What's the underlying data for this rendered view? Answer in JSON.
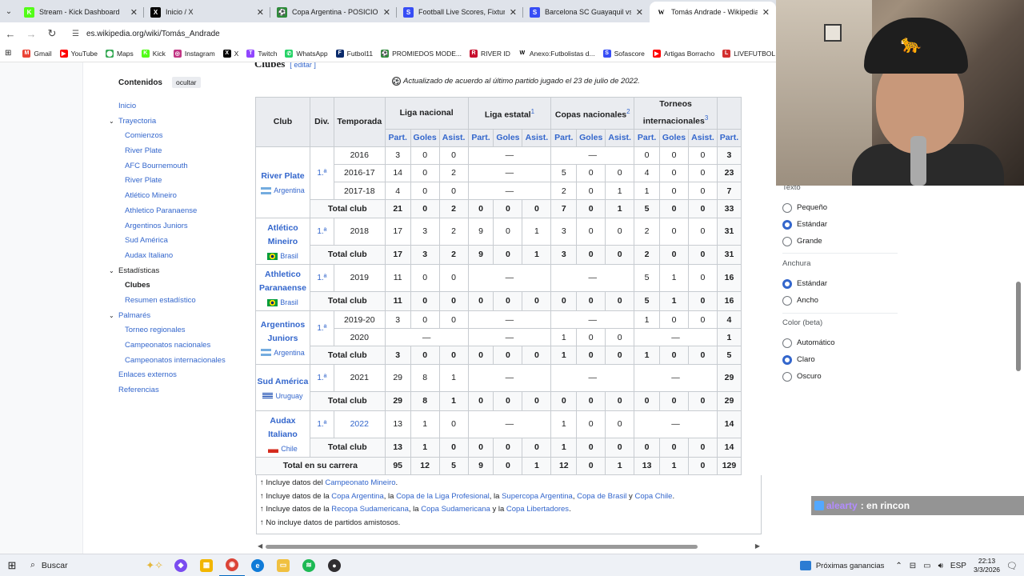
{
  "browser": {
    "tabs": [
      {
        "title": "Stream - Kick Dashboard",
        "icon": "kick-icon",
        "color": "#53fc18",
        "glyph": "K"
      },
      {
        "title": "Inicio / X",
        "icon": "x-icon",
        "color": "#000000",
        "glyph": "X"
      },
      {
        "title": "Copa Argentina - POSICIONES",
        "icon": "promiedos-icon",
        "color": "#2e8b3a",
        "glyph": "⚽"
      },
      {
        "title": "Football Live Scores, Fixtures &",
        "icon": "sofascore-icon",
        "color": "#374df5",
        "glyph": "S"
      },
      {
        "title": "Barcelona SC Guayaquil vs Bota",
        "icon": "sofascore-icon",
        "color": "#374df5",
        "glyph": "S"
      },
      {
        "title": "Tomás Andrade - Wikipedia, la",
        "icon": "wikipedia-icon",
        "color": "#ffffff",
        "glyph": "W"
      }
    ],
    "url": "es.wikipedia.org/wiki/Tomás_Andrade",
    "bookmarks": [
      {
        "label": "Gmail",
        "color": "#ea4335",
        "glyph": "M"
      },
      {
        "label": "YouTube",
        "color": "#ff0000",
        "glyph": "▶"
      },
      {
        "label": "Maps",
        "color": "#34a853",
        "glyph": "⬤"
      },
      {
        "label": "Kick",
        "color": "#53fc18",
        "glyph": "K"
      },
      {
        "label": "Instagram",
        "color": "#c13584",
        "glyph": "◎"
      },
      {
        "label": "X",
        "color": "#000000",
        "glyph": "X"
      },
      {
        "label": "Twitch",
        "color": "#9146ff",
        "glyph": "T"
      },
      {
        "label": "WhatsApp",
        "color": "#25d366",
        "glyph": "✆"
      },
      {
        "label": "Futbol11",
        "color": "#0a2b6b",
        "glyph": "F"
      },
      {
        "label": "PROMIEDOS MODE...",
        "color": "#2e8b3a",
        "glyph": "⚽"
      },
      {
        "label": "RIVER ID",
        "color": "#c8102e",
        "glyph": "R"
      },
      {
        "label": "Anexo:Futbolistas d...",
        "color": "#ffffff",
        "glyph": "W"
      },
      {
        "label": "Sofascore",
        "color": "#374df5",
        "glyph": "S"
      },
      {
        "label": "Artigas Borracho",
        "color": "#ff0000",
        "glyph": "▶"
      },
      {
        "label": "LIVEFUTBOL",
        "color": "#d32f2f",
        "glyph": "L"
      }
    ]
  },
  "toc": {
    "title": "Contenidos",
    "hide_label": "ocultar",
    "items": [
      {
        "label": "Inicio",
        "level": 1
      },
      {
        "label": "Trayectoria",
        "level": 1,
        "chev": true
      },
      {
        "label": "Comienzos",
        "level": 2
      },
      {
        "label": "River Plate",
        "level": 2
      },
      {
        "label": "AFC Bournemouth",
        "level": 2
      },
      {
        "label": "River Plate",
        "level": 2
      },
      {
        "label": "Atlético Mineiro",
        "level": 2
      },
      {
        "label": "Athletico Paranaense",
        "level": 2
      },
      {
        "label": "Argentinos Juniors",
        "level": 2
      },
      {
        "label": "Sud América",
        "level": 2
      },
      {
        "label": "Audax Italiano",
        "level": 2
      },
      {
        "label": "Estadísticas",
        "level": 1,
        "chev": true,
        "dark": true
      },
      {
        "label": "Clubes",
        "level": 2,
        "current": true
      },
      {
        "label": "Resumen estadístico",
        "level": 2
      },
      {
        "label": "Palmarés",
        "level": 1,
        "chev": true
      },
      {
        "label": "Torneo regionales",
        "level": 2
      },
      {
        "label": "Campeonatos nacionales",
        "level": 2
      },
      {
        "label": "Campeonatos internacionales",
        "level": 2
      },
      {
        "label": "Enlaces externos",
        "level": 1
      },
      {
        "label": "Referencias",
        "level": 1
      }
    ]
  },
  "article": {
    "section_title": "Clubes",
    "edit_label": "editar",
    "updated_note": "Actualizado de acuerdo al último partido jugado el 23 de julio de 2022.",
    "table": {
      "headers": {
        "club": "Club",
        "div": "Div.",
        "season": "Temporada",
        "groups": [
          {
            "label": "Liga nacional",
            "sup": ""
          },
          {
            "label": "Liga estatal",
            "sup": "1"
          },
          {
            "label": "Copas nacionales",
            "sup": "2"
          },
          {
            "label": "Torneos internacionales",
            "sup": "3"
          }
        ],
        "sub": [
          "Part.",
          "Goles",
          "Asist."
        ],
        "last_sub": "Part."
      },
      "clubs": [
        {
          "name": "River Plate",
          "country": "Argentina",
          "flag": "argentina",
          "div": "1.ª",
          "rows": [
            {
              "season": "2016",
              "cells": [
                "3",
                "0",
                "0",
                "—",
                "—",
                "0",
                "0",
                "0",
                "3"
              ]
            },
            {
              "season": "2016-17",
              "cells": [
                "14",
                "0",
                "2",
                "—",
                "5",
                "0",
                "0",
                "4",
                "0",
                "0",
                "23"
              ]
            },
            {
              "season": "2017-18",
              "cells": [
                "4",
                "0",
                "0",
                "—",
                "2",
                "0",
                "1",
                "1",
                "0",
                "0",
                "7"
              ]
            }
          ],
          "total": [
            "21",
            "0",
            "2",
            "0",
            "0",
            "0",
            "7",
            "0",
            "1",
            "5",
            "0",
            "0",
            "33"
          ]
        },
        {
          "name": "Atlético Mineiro",
          "country": "Brasil",
          "flag": "brasil",
          "div": "1.ª",
          "rows": [
            {
              "season": "2018",
              "cells": [
                "17",
                "3",
                "2",
                "9",
                "0",
                "1",
                "3",
                "0",
                "0",
                "2",
                "0",
                "0",
                "31"
              ]
            }
          ],
          "total": [
            "17",
            "3",
            "2",
            "9",
            "0",
            "1",
            "3",
            "0",
            "0",
            "2",
            "0",
            "0",
            "31"
          ]
        },
        {
          "name": "Athletico Paranaense",
          "country": "Brasil",
          "flag": "brasil",
          "div": "1.ª",
          "rows": [
            {
              "season": "2019",
              "cells": [
                "11",
                "0",
                "0",
                "—",
                "—",
                "5",
                "1",
                "0",
                "16"
              ]
            }
          ],
          "total": [
            "11",
            "0",
            "0",
            "0",
            "0",
            "0",
            "0",
            "0",
            "0",
            "5",
            "1",
            "0",
            "16"
          ]
        },
        {
          "name": "Argentinos Juniors",
          "country": "Argentina",
          "flag": "argentina",
          "div": "1.ª",
          "rows": [
            {
              "season": "2019-20",
              "cells": [
                "3",
                "0",
                "0",
                "—",
                "—",
                "1",
                "0",
                "0",
                "4"
              ]
            },
            {
              "season": "2020",
              "cells": [
                "—",
                "—",
                "1",
                "0",
                "0",
                "—",
                "1"
              ]
            }
          ],
          "total": [
            "3",
            "0",
            "0",
            "0",
            "0",
            "0",
            "1",
            "0",
            "0",
            "1",
            "0",
            "0",
            "5"
          ]
        },
        {
          "name": "Sud América",
          "country": "Uruguay",
          "flag": "uruguay",
          "div": "1.ª",
          "rows": [
            {
              "season": "2021",
              "cells": [
                "29",
                "8",
                "1",
                "—",
                "—",
                "—",
                "29"
              ]
            }
          ],
          "total": [
            "29",
            "8",
            "1",
            "0",
            "0",
            "0",
            "0",
            "0",
            "0",
            "0",
            "0",
            "0",
            "29"
          ]
        },
        {
          "name": "Audax Italiano",
          "country": "Chile",
          "flag": "chile",
          "div": "1.ª",
          "rows": [
            {
              "season": "2022",
              "cells": [
                "13",
                "1",
                "0",
                "—",
                "1",
                "0",
                "0",
                "—",
                "14"
              ]
            }
          ],
          "total": [
            "13",
            "1",
            "0",
            "0",
            "0",
            "0",
            "1",
            "0",
            "0",
            "0",
            "0",
            "0",
            "14"
          ]
        }
      ],
      "total_label": "Total club",
      "career_label": "Total en su carrera",
      "career": [
        "95",
        "12",
        "5",
        "9",
        "0",
        "1",
        "12",
        "0",
        "1",
        "13",
        "1",
        "0",
        "129"
      ]
    },
    "notes": [
      {
        "pre": "↑ Incluye datos del ",
        "links": [
          "Campeonato Mineiro"
        ],
        "seps": [],
        "post": "."
      },
      {
        "pre": "↑ Incluye datos de la ",
        "links": [
          "Copa Argentina",
          "Copa de la Liga Profesional",
          "Supercopa Argentina",
          "Copa de Brasil",
          "Copa Chile"
        ],
        "seps": [
          ", la ",
          ", la ",
          ", ",
          " y "
        ],
        "post": "."
      },
      {
        "pre": "↑ Incluye datos de la ",
        "links": [
          "Recopa Sudamericana",
          "Copa Sudamericana",
          "Copa Libertadores"
        ],
        "seps": [
          ", la ",
          " y la "
        ],
        "post": "."
      },
      {
        "pre": "↑ No incluye datos de partidos amistosos.",
        "links": [],
        "seps": [],
        "post": ""
      }
    ]
  },
  "appearance": {
    "text_label": "Texto",
    "text_options": [
      {
        "label": "Pequeño",
        "on": false
      },
      {
        "label": "Estándar",
        "on": true
      },
      {
        "label": "Grande",
        "on": false
      }
    ],
    "width_label": "Anchura",
    "width_options": [
      {
        "label": "Estándar",
        "on": true
      },
      {
        "label": "Ancho",
        "on": false
      }
    ],
    "color_label": "Color (beta)",
    "color_options": [
      {
        "label": "Automático",
        "on": false
      },
      {
        "label": "Claro",
        "on": true
      },
      {
        "label": "Oscuro",
        "on": false
      }
    ]
  },
  "chat": {
    "user": "alearty",
    "message": ": en rincon"
  },
  "taskbar": {
    "search_placeholder": "Buscar",
    "news": "Próximas ganancias",
    "lang": "ESP",
    "time": "22:13",
    "date": "3/3/2026"
  }
}
